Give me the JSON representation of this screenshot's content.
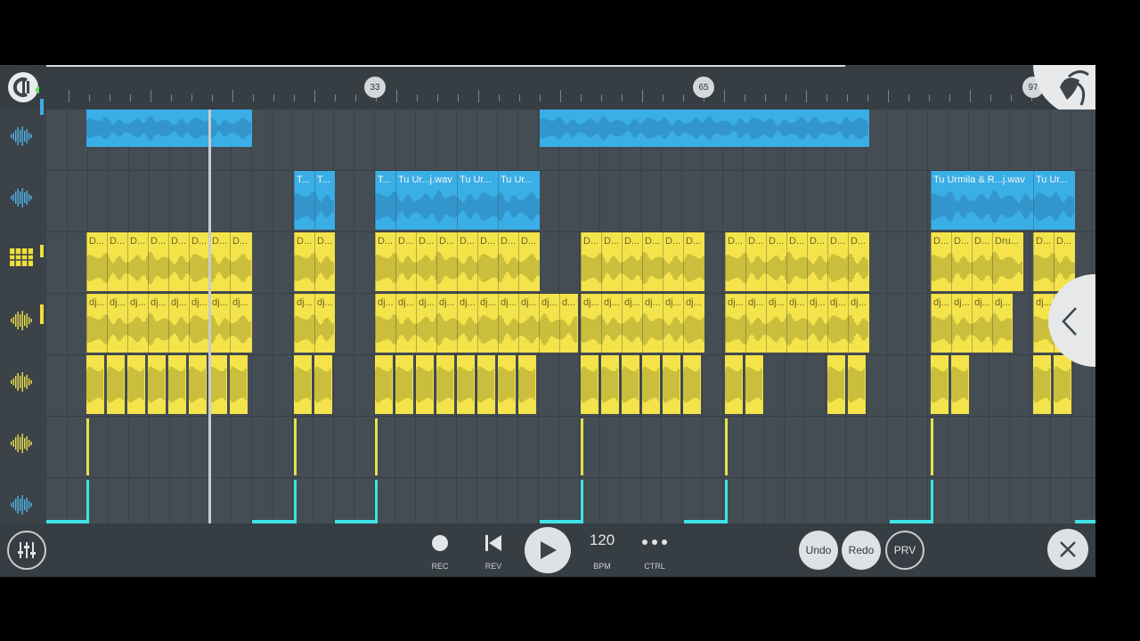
{
  "ruler": {
    "markers": [
      "33",
      "65",
      "97"
    ]
  },
  "clips": {
    "blue_long_label": "",
    "t_label": "T...",
    "tu_ur_label": "Tu Ur...",
    "tu_ur_wav_label": "Tu Ur...j.wav",
    "tu_urmila_label": "Tu Urmila & R...j.wav",
    "d_label": "D...",
    "dru_label": "Dru...",
    "dj_label": "dj...",
    "d_short_label": "d..."
  },
  "transport": {
    "rec_label": "REC",
    "rev_label": "REV",
    "tempo": "120",
    "tempo_label": "BPM",
    "ctrl_label": "CTRL",
    "undo_label": "Undo",
    "redo_label": "Redo",
    "prv_label": "PRV"
  },
  "colors": {
    "audio_clip": "#3aaee6",
    "pattern_clip": "#f4e34a",
    "loop_marker": "#3fe3e6",
    "background": "#434b52"
  },
  "icons": [
    "channel-icon",
    "waveform-icon",
    "piano-roll-icon",
    "mixer-icon",
    "play-icon",
    "rewind-icon",
    "record-icon",
    "close-icon",
    "chevron-left-icon",
    "fl-fruit-icon"
  ]
}
